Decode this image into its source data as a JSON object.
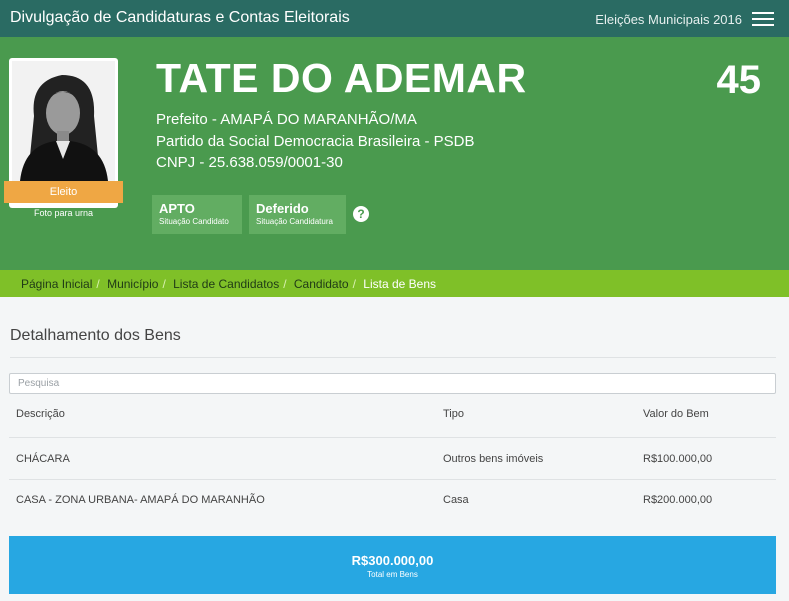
{
  "header": {
    "title": "Divulgação de Candidaturas e Contas Eleitorais",
    "election": "Eleições Municipais 2016"
  },
  "candidate": {
    "name": "TATE DO ADEMAR",
    "number": "45",
    "office_line": "Prefeito - AMAPÁ DO MARANHÃO/MA",
    "party_line": "Partido da Social Democracia Brasileira - PSDB",
    "cnpj_line": "CNPJ - 25.638.059/0001-30",
    "result": "Eleito",
    "photo_caption": "Foto para urna"
  },
  "status": [
    {
      "value": "APTO",
      "label": "Situação Candidato"
    },
    {
      "value": "Deferido",
      "label": "Situação Candidatura"
    }
  ],
  "help_glyph": "?",
  "breadcrumb": {
    "items": [
      "Página Inicial",
      "Município",
      "Lista de Candidatos",
      "Candidato"
    ],
    "current": "Lista de Bens",
    "separator": "/"
  },
  "assets": {
    "title": "Detalhamento dos Bens",
    "search_placeholder": "Pesquisa",
    "columns": [
      "Descrição",
      "Tipo",
      "Valor do Bem"
    ],
    "rows": [
      {
        "descricao": "CHÁCARA",
        "tipo": "Outros bens imóveis",
        "valor": "R$100.000,00"
      },
      {
        "descricao": "CASA - ZONA URBANA- AMAPÁ DO MARANHÃO",
        "tipo": "Casa",
        "valor": "R$200.000,00"
      }
    ],
    "total_value": "R$300.000,00",
    "total_label": "Total em Bens"
  },
  "colors": {
    "topbar": "#2a6b63",
    "hero": "#4a9a4e",
    "breadcrumb": "#7fc028",
    "elected_badge": "#efa744",
    "total_bar": "#27a7e2"
  }
}
